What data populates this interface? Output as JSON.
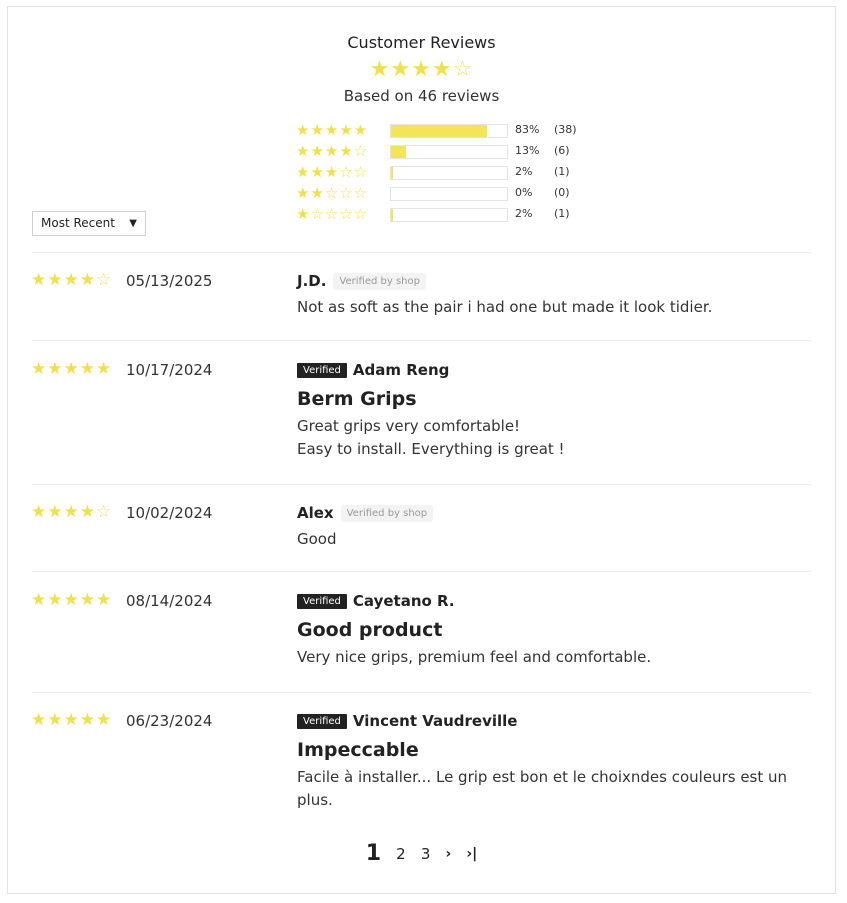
{
  "summary": {
    "title": "Customer Reviews",
    "average_stars": "★★★★☆",
    "based_on": "Based on 46 reviews"
  },
  "histogram": [
    {
      "stars": "★★★★★",
      "fill": 0.83,
      "percent": "83%",
      "count": "(38)"
    },
    {
      "stars": "★★★★☆",
      "fill": 0.13,
      "percent": "13%",
      "count": "(6)"
    },
    {
      "stars": "★★★☆☆",
      "fill": 0.02,
      "percent": "2%",
      "count": "(1)"
    },
    {
      "stars": "★★☆☆☆",
      "fill": 0.0,
      "percent": "0%",
      "count": "(0)"
    },
    {
      "stars": "★☆☆☆☆",
      "fill": 0.02,
      "percent": "2%",
      "count": "(1)"
    }
  ],
  "sort": {
    "label": "Most Recent",
    "caret": "▼"
  },
  "reviews": [
    {
      "stars": "★★★★☆",
      "date": "05/13/2025",
      "author": "J.D.",
      "verified_badge": "",
      "verified_by_shop": "Verified by shop",
      "title": "",
      "text": "Not as soft as the pair i had one but made it look tidier."
    },
    {
      "stars": "★★★★★",
      "date": "10/17/2024",
      "author": "Adam Reng",
      "verified_badge": "Verified",
      "verified_by_shop": "",
      "title": "Berm Grips",
      "text": "Great grips very comfortable!\nEasy to install. Everything is great !"
    },
    {
      "stars": "★★★★☆",
      "date": "10/02/2024",
      "author": "Alex",
      "verified_badge": "",
      "verified_by_shop": "Verified by shop",
      "title": "",
      "text": "Good"
    },
    {
      "stars": "★★★★★",
      "date": "08/14/2024",
      "author": "Cayetano R.",
      "verified_badge": "Verified",
      "verified_by_shop": "",
      "title": "Good product",
      "text": "Very nice grips, premium feel and comfortable."
    },
    {
      "stars": "★★★★★",
      "date": "06/23/2024",
      "author": "Vincent Vaudreville",
      "verified_badge": "Verified",
      "verified_by_shop": "",
      "title": "Impeccable",
      "text": "Facile à installer... Le grip est bon et le choixndes couleurs est un plus."
    }
  ],
  "pagination": {
    "current": "1",
    "pages": [
      "2",
      "3"
    ],
    "next_icon": "chevron-right-icon",
    "last_icon": "last-page-icon",
    "next_glyph": "›",
    "last_glyph": "›|"
  },
  "colors": {
    "star": "#f1df4b",
    "bar_fill": "#f4e45a",
    "badge": "#222222"
  }
}
